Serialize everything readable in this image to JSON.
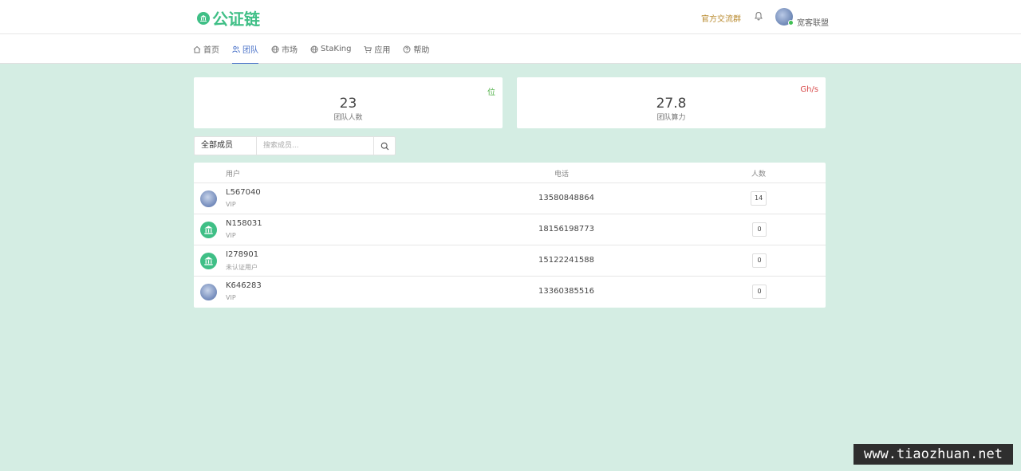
{
  "header": {
    "logo_text": "公证链",
    "group_link": "官方交流群",
    "username": "宽客联盟"
  },
  "nav": [
    {
      "label": "首页",
      "icon": "home-icon",
      "active": false
    },
    {
      "label": "团队",
      "icon": "team-icon",
      "active": true
    },
    {
      "label": "市场",
      "icon": "globe-icon",
      "active": false
    },
    {
      "label": "StaKing",
      "icon": "globe-icon",
      "active": false
    },
    {
      "label": "应用",
      "icon": "cart-icon",
      "active": false
    },
    {
      "label": "帮助",
      "icon": "help-icon",
      "active": false
    }
  ],
  "stats": [
    {
      "unit": "位",
      "unit_color": "#52b24a",
      "value": "23",
      "label": "团队人数"
    },
    {
      "unit": "Gh/s",
      "unit_color": "#d84a4a",
      "value": "27.8",
      "label": "团队算力"
    }
  ],
  "filter": {
    "select_value": "全部成员",
    "search_placeholder": "搜索成员..."
  },
  "table": {
    "headers": {
      "user": "用户",
      "phone": "电话",
      "count": "人数"
    },
    "rows": [
      {
        "name": "L567040",
        "level": "VIP",
        "phone": "13580848864",
        "count": "14",
        "avatar": "photo"
      },
      {
        "name": "N158031",
        "level": "VIP",
        "phone": "18156198773",
        "count": "0",
        "avatar": "bank"
      },
      {
        "name": "I278901",
        "level": "未认证用户",
        "phone": "15122241588",
        "count": "0",
        "avatar": "bank"
      },
      {
        "name": "K646283",
        "level": "VIP",
        "phone": "13360385516",
        "count": "0",
        "avatar": "photo"
      }
    ]
  },
  "watermark": "www.tiaozhuan.net",
  "colors": {
    "brand": "#3fbf86",
    "accent": "#4a72c8",
    "background": "#d4ede3"
  }
}
